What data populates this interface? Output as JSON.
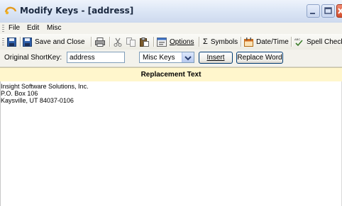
{
  "window": {
    "title": "Modify Keys - [address]"
  },
  "menu": {
    "items": [
      "File",
      "Edit",
      "Misc"
    ]
  },
  "toolbar": {
    "save_label": "",
    "save_close_label": "Save and Close",
    "options_label": "Options",
    "symbols_label": "Symbols",
    "datetime_label": "Date/Time",
    "spellcheck_label": "Spell Check"
  },
  "shortkey": {
    "label": "Original ShortKey:",
    "value": "address",
    "dropdown_value": "Misc Keys",
    "insert_label": "Insert",
    "replace_word_label": "Replace Word"
  },
  "replacement": {
    "header": "Replacement Text",
    "lines": [
      "Insight Software Solutions, Inc.",
      "P.O. Box 106",
      "Kaysville, UT 84037-0106"
    ]
  },
  "icons": [
    "app-icon",
    "minimize-icon",
    "maximize-icon",
    "close-icon",
    "save-icon",
    "save-close-icon",
    "print-icon",
    "cut-icon",
    "copy-icon",
    "paste-icon",
    "options-icon",
    "sigma-icon",
    "calendar-icon",
    "spellcheck-icon",
    "chevron-down-icon"
  ],
  "colors": {
    "title_bg": "#dde7f6",
    "close_button": "#d24d2b",
    "header_bg": "#fff6cc"
  }
}
